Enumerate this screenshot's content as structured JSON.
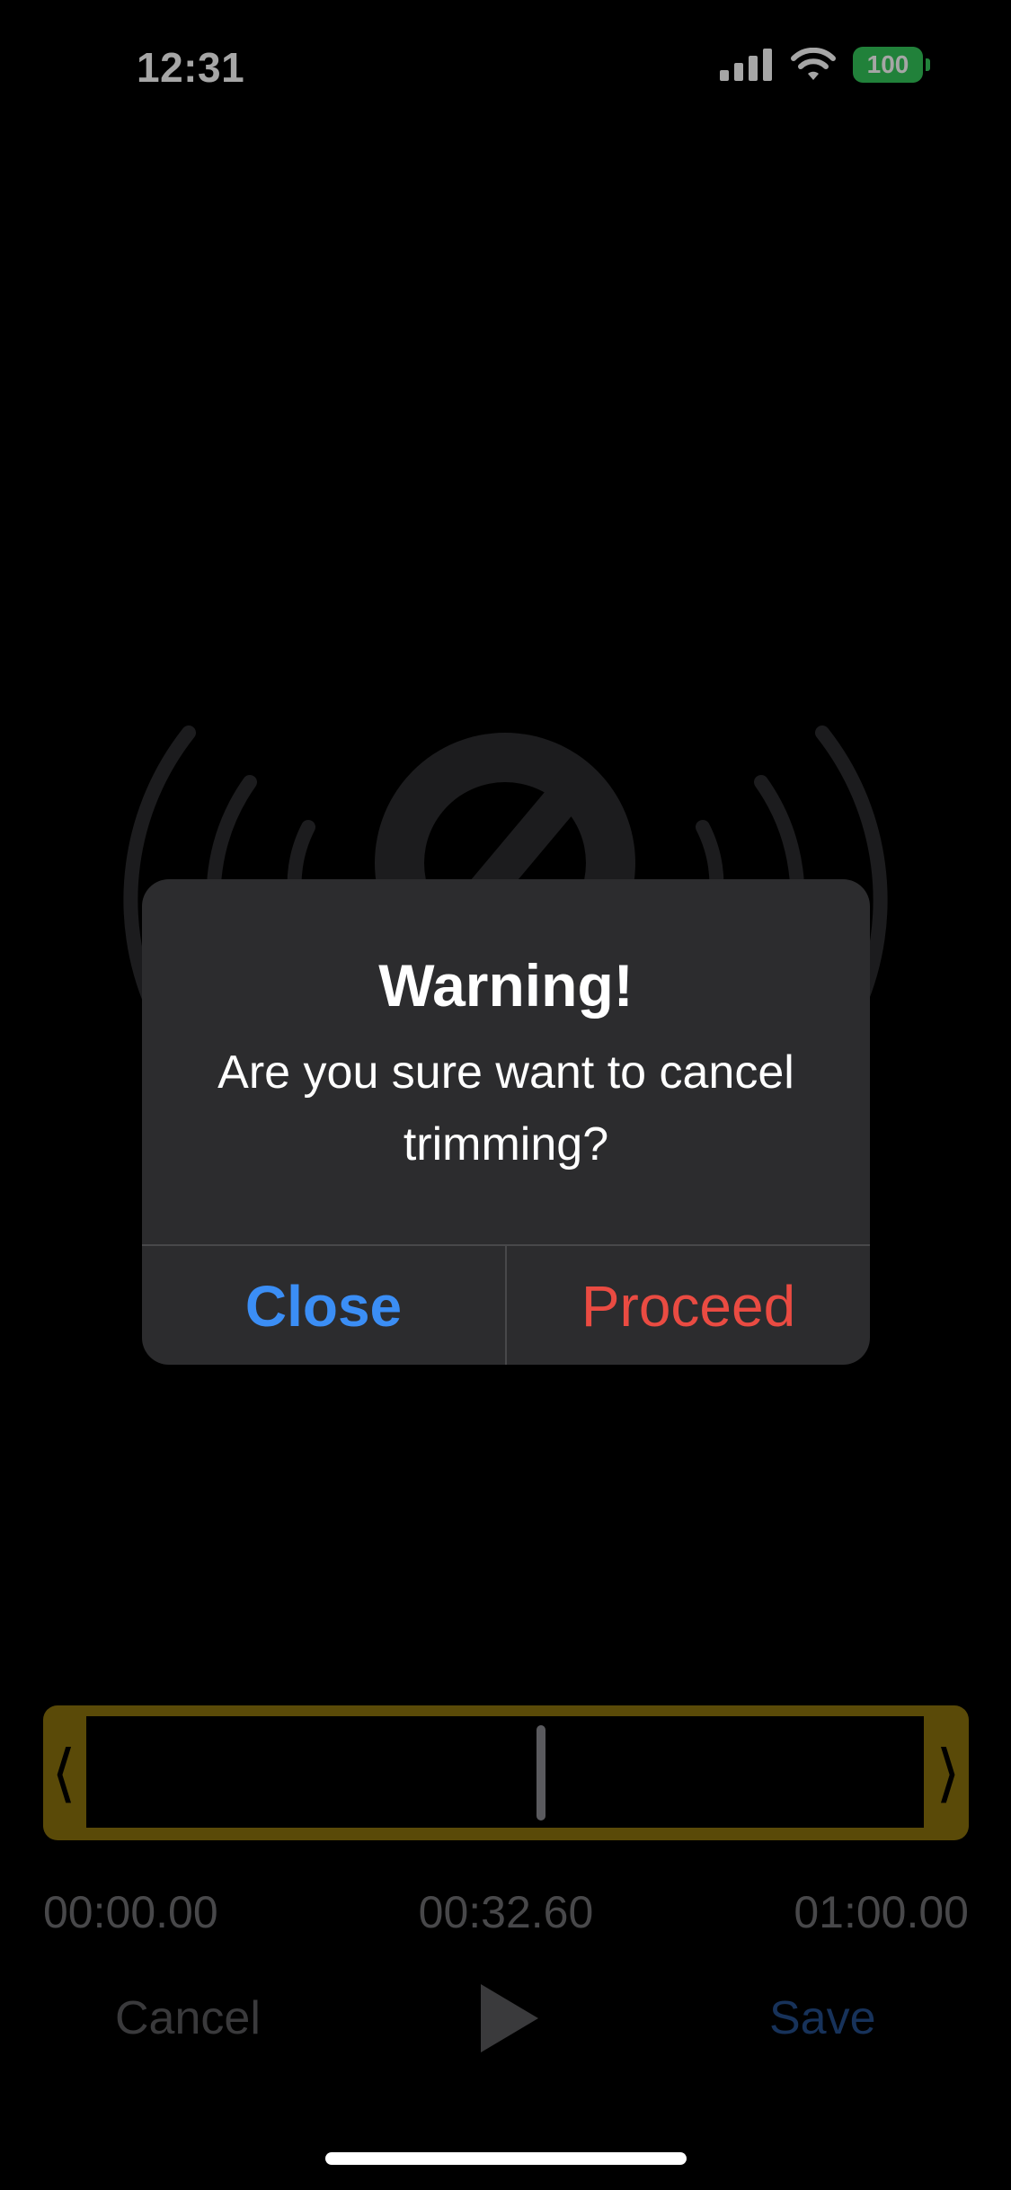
{
  "status_bar": {
    "time": "12:31",
    "battery": "100",
    "battery_color": "#34c759"
  },
  "background": {
    "illustration_icon": "audio-broadcast-icon"
  },
  "alert": {
    "title": "Warning!",
    "message": "Are you sure want to cancel trimming?",
    "close_label": "Close",
    "proceed_label": "Proceed",
    "close_color": "#3b8ef5",
    "proceed_color": "#ea4b42"
  },
  "trimmer": {
    "left_handle": "⟨",
    "right_handle": "⟩",
    "start_time": "00:00.00",
    "current_time": "00:32.60",
    "end_time": "01:00.00",
    "playhead_fraction": 0.543
  },
  "actions": {
    "cancel_label": "Cancel",
    "play_icon": "play-icon",
    "save_label": "Save"
  }
}
